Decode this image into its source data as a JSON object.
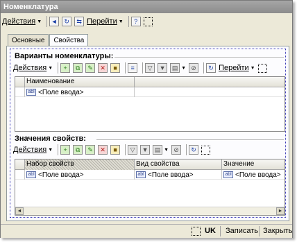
{
  "window": {
    "title": "Номенклатура"
  },
  "toolbar": {
    "actions_label": "Действия",
    "goto_label": "Перейти",
    "help_label": "?"
  },
  "tabs": [
    {
      "label": "Основные"
    },
    {
      "label": "Свойства"
    }
  ],
  "variants": {
    "title": "Варианты номенклатуры:",
    "actions_label": "Действия",
    "goto_label": "Перейти",
    "columns": [
      "Наименование"
    ],
    "rows": [
      {
        "name": "<Поле ввода>"
      }
    ]
  },
  "properties": {
    "title": "Значения свойств:",
    "actions_label": "Действия",
    "columns": [
      "Набор свойств",
      "Вид свойства",
      "Значение"
    ],
    "rows": [
      {
        "set": "<Поле ввода>",
        "kind": "<Поле ввода>",
        "value": "<Поле ввода>"
      }
    ]
  },
  "field_icon_text": "abl",
  "status_bar": {
    "language": "UK",
    "save_label": "Записать",
    "close_label": "Закрыть"
  }
}
